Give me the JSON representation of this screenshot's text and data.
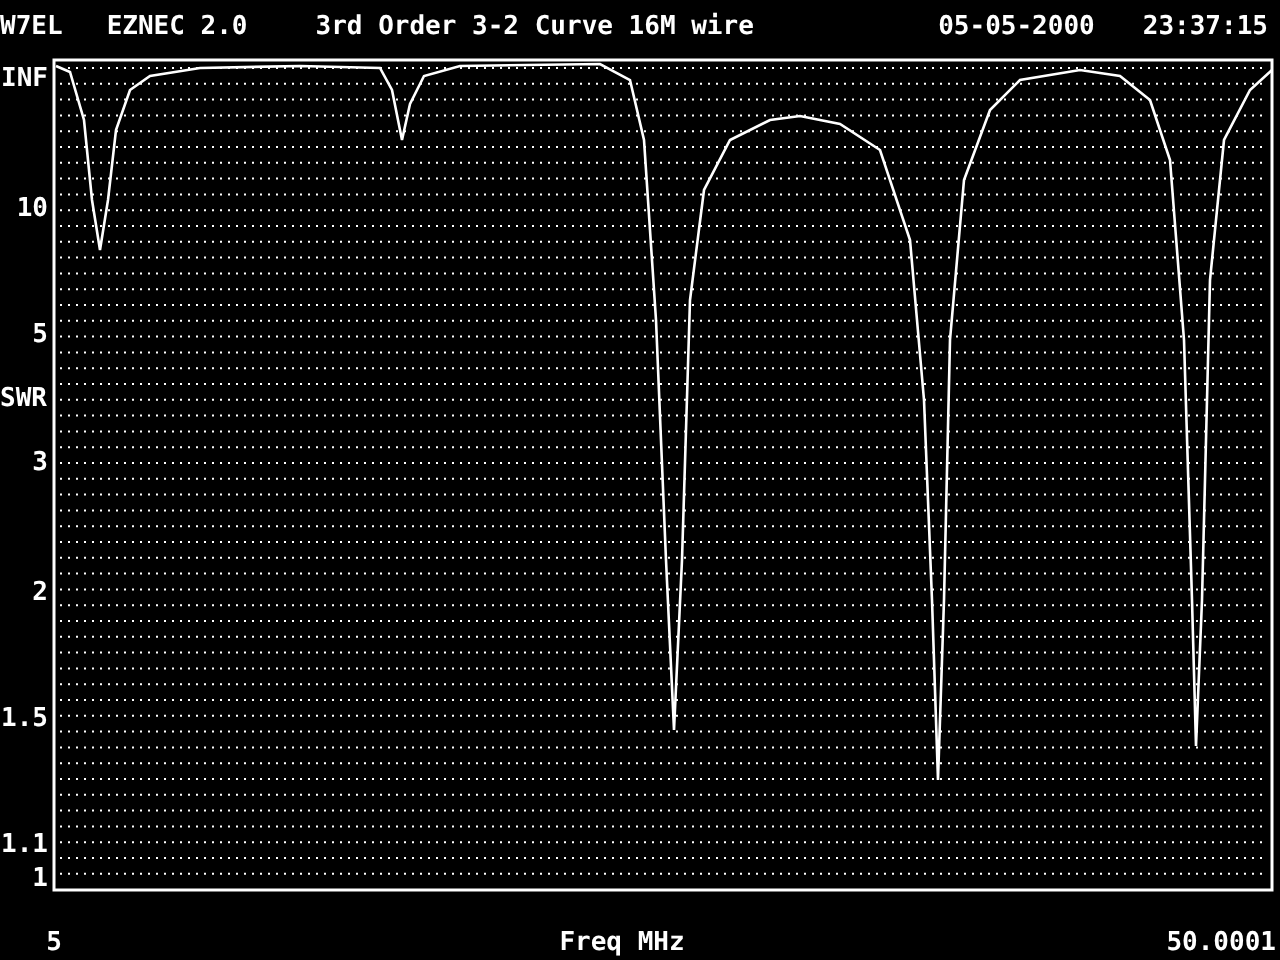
{
  "header": {
    "author": "W7EL",
    "program": "EZNEC 2.0",
    "date": "05-05-2000",
    "time": "23:37:15"
  },
  "plot": {
    "title": "3rd Order 3-2 Curve 16M wire",
    "y_axis_label": "SWR",
    "x_axis_label": "Freq MHz",
    "y_tick_labels": [
      "INF",
      "10",
      "5",
      "3",
      "2",
      "1.5",
      "1.1",
      "1"
    ],
    "x_tick_labels": [
      "5",
      "50.0001"
    ]
  }
}
